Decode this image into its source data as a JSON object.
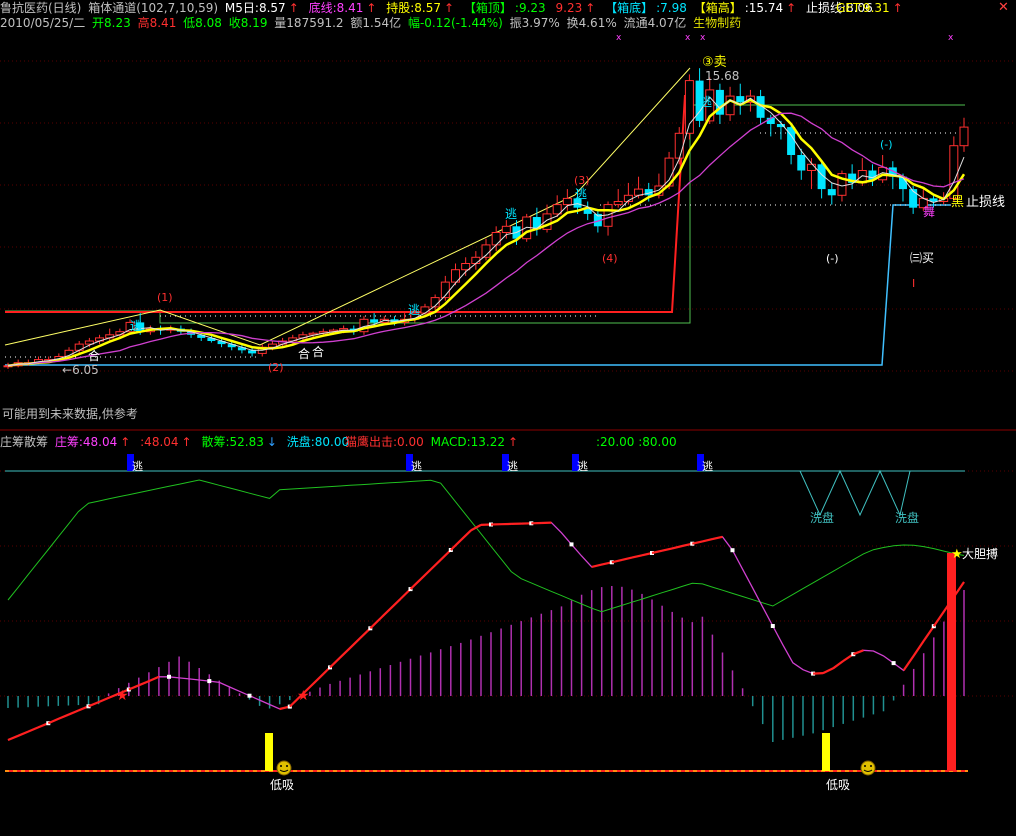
{
  "header1": {
    "stock": "鲁抗医药(日线)",
    "indicator": "箱体通道(102,7,10,59)",
    "m5": "M5日:8.57",
    "bottom_line": "底线:8.41",
    "hold": "持股:8.57",
    "box_top_label": "【箱顶】",
    "box_top_vals": ":9.23",
    "box_top_val2": "9.23",
    "box_bottom_label": "【箱底】",
    "box_bottom_val": ":7.98",
    "box_high_label": "【箱高】",
    "box_high_val": ":15.74",
    "stop_line": "止损线:8.06",
    "get": "GET:9.31"
  },
  "header2": {
    "date": "2010/05/25/二",
    "open": "开8.23",
    "high": "高8.41",
    "low": "低8.08",
    "close": "收8.19",
    "volume": "量187591.2",
    "amount": "额1.54亿",
    "change": "幅-0.12(-1.44%)",
    "amplitude": "振3.97%",
    "turnover": "换4.61%",
    "float": "流通4.07亿",
    "sector": "生物制药"
  },
  "note": "可能用到未来数据,供参考",
  "header3": {
    "name": "庄筹散筹",
    "zhuang": "庄筹:48.04",
    "zhuang2": ":48.04",
    "san": "散筹:52.83",
    "wash": "洗盘:80.00",
    "eagle": "猫鹰出击:0.00",
    "macd": "MACD:13.22",
    "lines": ":20.00  :80.00"
  },
  "labels": {
    "price_min": "6.05",
    "price_max": "15.68",
    "sell3": "③卖",
    "buy3": "㈢买",
    "stop_loss": "止损线",
    "escape": "逃",
    "he": "合",
    "wash": "洗盘",
    "low_suck": "低吸",
    "bold": "大胆搏",
    "minus": "(-)",
    "l1": "(1)",
    "l2": "(2)",
    "l3": "(3)",
    "l4": "(4)",
    "marker_i": "I",
    "dance": "舞",
    "black": "黑"
  },
  "colors": {
    "up": "#ff3030",
    "down": "#00e5ff",
    "yellow": "#ffff00",
    "magenta": "#ff40ff",
    "green": "#00ff00",
    "box_line": "#ff3030",
    "cyan_line": "#40c0ff"
  },
  "chart_data": {
    "type": "candlestick",
    "candles": [
      [
        6.1,
        6.1,
        6.2,
        6.0
      ],
      [
        6.1,
        6.2,
        6.3,
        6.05
      ],
      [
        6.2,
        6.2,
        6.3,
        6.1
      ],
      [
        6.2,
        6.3,
        6.4,
        6.15
      ],
      [
        6.25,
        6.3,
        6.4,
        6.2
      ],
      [
        6.3,
        6.4,
        6.5,
        6.25
      ],
      [
        6.4,
        6.6,
        6.7,
        6.35
      ],
      [
        6.6,
        6.8,
        6.9,
        6.5
      ],
      [
        6.8,
        6.9,
        7.0,
        6.7
      ],
      [
        6.9,
        7.0,
        7.1,
        6.8
      ],
      [
        7.0,
        7.1,
        7.3,
        6.9
      ],
      [
        7.1,
        7.2,
        7.3,
        7.0
      ],
      [
        7.2,
        7.5,
        7.6,
        7.1
      ],
      [
        7.5,
        7.2,
        7.8,
        7.1
      ],
      [
        7.2,
        7.3,
        7.4,
        7.1
      ],
      [
        7.3,
        7.25,
        7.4,
        7.1
      ],
      [
        7.25,
        7.3,
        7.4,
        7.15
      ],
      [
        7.3,
        7.2,
        7.4,
        7.1
      ],
      [
        7.2,
        7.1,
        7.3,
        7.0
      ],
      [
        7.1,
        7.0,
        7.2,
        6.9
      ],
      [
        7.0,
        6.9,
        7.1,
        6.85
      ],
      [
        6.9,
        6.8,
        7.0,
        6.7
      ],
      [
        6.8,
        6.7,
        6.9,
        6.6
      ],
      [
        6.7,
        6.6,
        6.8,
        6.5
      ],
      [
        6.6,
        6.5,
        6.7,
        6.4
      ],
      [
        6.5,
        6.7,
        6.8,
        6.4
      ],
      [
        6.7,
        6.8,
        6.9,
        6.6
      ],
      [
        6.8,
        6.9,
        7.0,
        6.7
      ],
      [
        6.9,
        7.0,
        7.1,
        6.8
      ],
      [
        7.0,
        7.1,
        7.2,
        6.9
      ],
      [
        7.1,
        7.15,
        7.2,
        7.0
      ],
      [
        7.15,
        7.2,
        7.3,
        7.05
      ],
      [
        7.2,
        7.25,
        7.3,
        7.1
      ],
      [
        7.25,
        7.3,
        7.4,
        7.15
      ],
      [
        7.3,
        7.2,
        7.4,
        7.1
      ],
      [
        7.2,
        7.6,
        7.7,
        7.1
      ],
      [
        7.6,
        7.5,
        7.8,
        7.4
      ],
      [
        7.5,
        7.6,
        7.7,
        7.4
      ],
      [
        7.6,
        7.5,
        7.7,
        7.4
      ],
      [
        7.5,
        7.6,
        7.8,
        7.4
      ],
      [
        7.6,
        7.8,
        7.9,
        7.5
      ],
      [
        7.8,
        8.0,
        8.1,
        7.7
      ],
      [
        8.0,
        8.3,
        8.4,
        7.9
      ],
      [
        8.3,
        8.8,
        9.0,
        8.2
      ],
      [
        8.8,
        9.2,
        9.4,
        8.7
      ],
      [
        9.2,
        9.4,
        9.6,
        9.0
      ],
      [
        9.4,
        9.6,
        9.8,
        9.2
      ],
      [
        9.6,
        10.0,
        10.2,
        9.5
      ],
      [
        10.0,
        10.4,
        10.6,
        9.8
      ],
      [
        10.4,
        10.6,
        10.8,
        10.2
      ],
      [
        10.6,
        10.2,
        10.8,
        10.0
      ],
      [
        10.2,
        10.9,
        11.0,
        10.1
      ],
      [
        10.9,
        10.5,
        11.2,
        10.3
      ],
      [
        10.5,
        11.0,
        11.3,
        10.4
      ],
      [
        11.0,
        11.3,
        11.6,
        10.9
      ],
      [
        11.3,
        11.5,
        11.8,
        11.1
      ],
      [
        11.5,
        11.2,
        11.8,
        11.0
      ],
      [
        11.2,
        11.0,
        11.4,
        10.8
      ],
      [
        11.0,
        10.6,
        11.1,
        10.4
      ],
      [
        10.6,
        11.3,
        11.4,
        10.3
      ],
      [
        11.3,
        11.4,
        11.8,
        11.2
      ],
      [
        11.4,
        11.6,
        12.0,
        11.3
      ],
      [
        11.6,
        11.8,
        12.2,
        11.5
      ],
      [
        11.8,
        11.6,
        12.0,
        11.4
      ],
      [
        11.6,
        11.9,
        12.3,
        11.5
      ],
      [
        11.9,
        12.8,
        13.0,
        11.8
      ],
      [
        12.8,
        13.6,
        13.8,
        12.6
      ],
      [
        13.6,
        15.3,
        15.5,
        13.4
      ],
      [
        15.3,
        14.0,
        15.7,
        13.8
      ],
      [
        14.0,
        15.0,
        15.4,
        13.9
      ],
      [
        15.0,
        14.2,
        15.2,
        13.9
      ],
      [
        14.2,
        14.8,
        15.1,
        14.0
      ],
      [
        14.8,
        14.6,
        15.2,
        14.2
      ],
      [
        14.6,
        14.8,
        15.0,
        14.3
      ],
      [
        14.8,
        14.1,
        15.0,
        13.9
      ],
      [
        14.1,
        13.9,
        14.2,
        13.5
      ],
      [
        13.9,
        13.8,
        14.0,
        13.4
      ],
      [
        13.8,
        12.9,
        13.9,
        12.6
      ],
      [
        12.9,
        12.4,
        13.1,
        12.1
      ],
      [
        12.4,
        12.6,
        12.8,
        11.8
      ],
      [
        12.6,
        11.8,
        12.7,
        11.5
      ],
      [
        11.8,
        11.6,
        12.0,
        11.3
      ],
      [
        11.6,
        12.3,
        12.4,
        11.4
      ],
      [
        12.3,
        12.0,
        12.6,
        11.8
      ],
      [
        12.0,
        12.4,
        12.8,
        11.9
      ],
      [
        12.4,
        12.1,
        12.6,
        11.9
      ],
      [
        12.1,
        12.5,
        12.9,
        12.0
      ],
      [
        12.5,
        12.2,
        12.7,
        11.8
      ],
      [
        12.2,
        11.8,
        12.3,
        11.4
      ],
      [
        11.8,
        11.2,
        11.9,
        11.0
      ],
      [
        11.2,
        11.5,
        11.8,
        11.1
      ],
      [
        11.5,
        11.4,
        11.6,
        11.2
      ],
      [
        11.4,
        11.5,
        11.7,
        11.3
      ],
      [
        11.5,
        13.2,
        13.5,
        11.4
      ],
      [
        13.2,
        13.8,
        14.1,
        13.0
      ]
    ]
  }
}
